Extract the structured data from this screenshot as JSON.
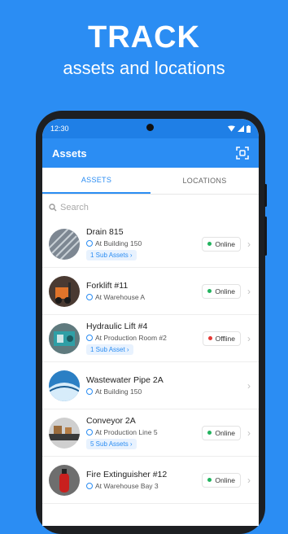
{
  "hero": {
    "title": "TRACK",
    "subtitle": "assets and locations"
  },
  "status_bar": {
    "time": "12:30",
    "icons": [
      "wifi-icon",
      "signal-icon",
      "battery-icon"
    ]
  },
  "appbar": {
    "title": "Assets",
    "action_icon": "scan-icon"
  },
  "tabs": [
    {
      "label": "ASSETS",
      "active": true
    },
    {
      "label": "LOCATIONS",
      "active": false
    }
  ],
  "search": {
    "placeholder": "Search"
  },
  "colors": {
    "brand": "#2b8df3",
    "online": "#22b35e",
    "offline": "#e53935"
  },
  "assets": [
    {
      "name": "Drain 815",
      "location": "At Building 150",
      "sub_assets": "1 Sub Assets",
      "status": "Online",
      "thumb": "drain"
    },
    {
      "name": "Forklift #11",
      "location": "At Warehouse A",
      "sub_assets": null,
      "status": "Online",
      "thumb": "forklift"
    },
    {
      "name": "Hydraulic Lift #4",
      "location": "At Production Room #2",
      "sub_assets": "1 Sub Asset",
      "status": "Offline",
      "thumb": "lift"
    },
    {
      "name": "Wastewater Pipe 2A",
      "location": "At Building 150",
      "sub_assets": null,
      "status": null,
      "thumb": "pipe"
    },
    {
      "name": "Conveyor 2A",
      "location": "At Production Line 5",
      "sub_assets": "5 Sub Assets",
      "status": "Online",
      "thumb": "conveyor"
    },
    {
      "name": "Fire Extinguisher #12",
      "location": "At Warehouse Bay 3",
      "sub_assets": null,
      "status": "Online",
      "thumb": "extinguisher"
    }
  ]
}
